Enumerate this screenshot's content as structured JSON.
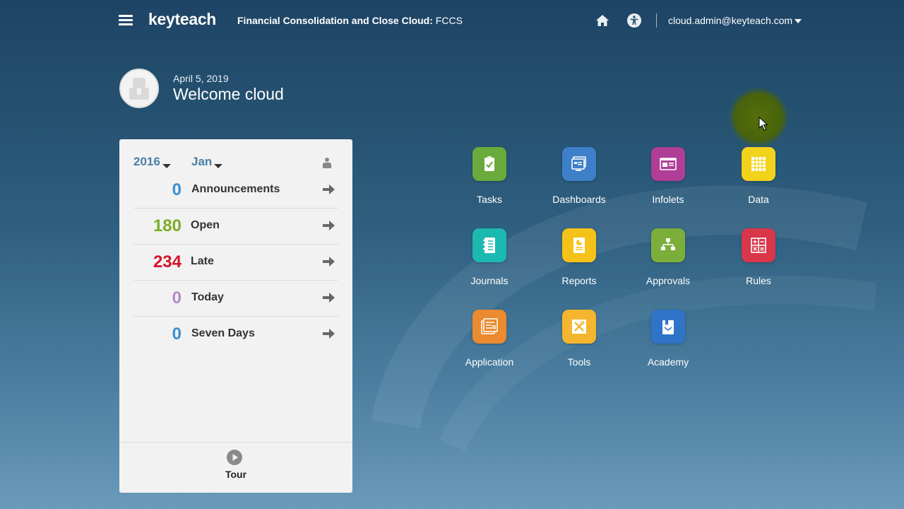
{
  "header": {
    "logo": "keyteach",
    "app_title_bold": "Financial Consolidation and Close Cloud:",
    "app_title_name": " FCCS",
    "user": "cloud.admin@keyteach.com"
  },
  "welcome": {
    "date": "April 5, 2019",
    "greeting": "Welcome cloud"
  },
  "panel": {
    "year": "2016",
    "period": "Jan",
    "rows": [
      {
        "count": "0",
        "label": "Announcements",
        "color": "#3a8fd1"
      },
      {
        "count": "180",
        "label": "Open",
        "color": "#7cae29"
      },
      {
        "count": "234",
        "label": "Late",
        "color": "#d4142a"
      },
      {
        "count": "0",
        "label": "Today",
        "color": "#b48ac6"
      },
      {
        "count": "0",
        "label": "Seven Days",
        "color": "#3a8fd1"
      }
    ],
    "tour_label": "Tour"
  },
  "tiles": [
    {
      "label": "Tasks",
      "icon": "task-check-icon",
      "color": "#6aaa3c"
    },
    {
      "label": "Dashboards",
      "icon": "dashboard-icon",
      "color": "#3d7fc8"
    },
    {
      "label": "Infolets",
      "icon": "infolet-icon",
      "color": "#b03d96"
    },
    {
      "label": "Data",
      "icon": "data-grid-icon",
      "color": "#f2d21b"
    },
    {
      "label": "Journals",
      "icon": "journal-icon",
      "color": "#1cb9b0"
    },
    {
      "label": "Reports",
      "icon": "report-icon",
      "color": "#f5c219"
    },
    {
      "label": "Approvals",
      "icon": "approvals-icon",
      "color": "#7cae3c"
    },
    {
      "label": "Rules",
      "icon": "rules-icon",
      "color": "#d9364a"
    },
    {
      "label": "Application",
      "icon": "application-icon",
      "color": "#eb8a2f"
    },
    {
      "label": "Tools",
      "icon": "tools-icon",
      "color": "#f3b62e"
    },
    {
      "label": "Academy",
      "icon": "academy-icon",
      "color": "#2f74c9"
    }
  ]
}
